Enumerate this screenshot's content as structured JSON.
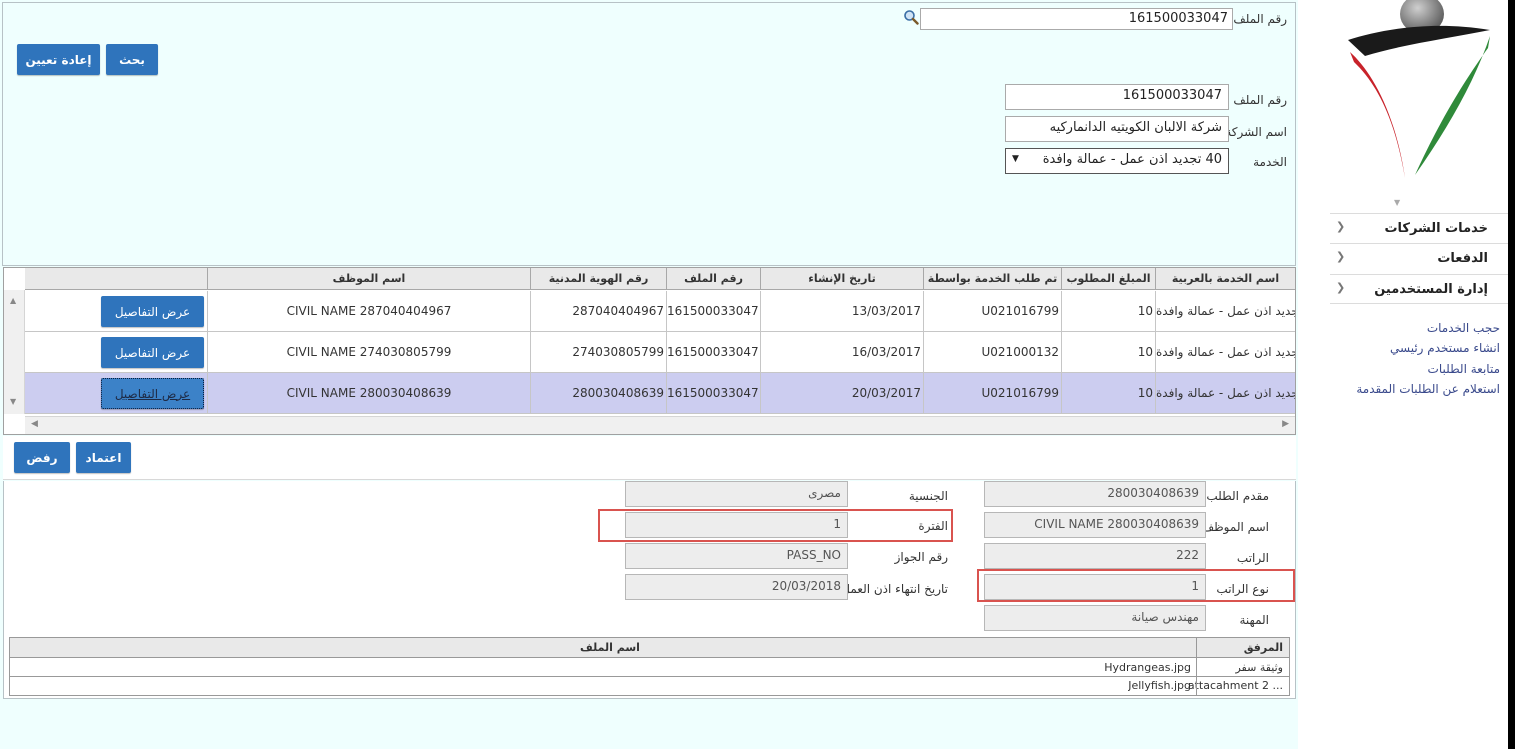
{
  "search": {
    "label": "رقم الملف",
    "value": "161500033047",
    "search_button": "بحث",
    "reset_button": "إعادة تعيين"
  },
  "file_info": {
    "file_no_label": "رقم الملف",
    "file_no_value": "161500033047",
    "company_label": "اسم الشركة",
    "company_value": "شركة الالبان الكويتيه الدانماركيه",
    "service_label": "الخدمة",
    "service_value": "40 تجديد اذن عمل - عمالة وافدة"
  },
  "grid": {
    "columns": [
      "اسم الخدمة بالعربية",
      "المبلغ المطلوب",
      "تم طلب الخدمة بواسطة",
      "تاريخ الإنشاء",
      "رقم الملف",
      "رقم الهوية المدنية",
      "اسم الموظف"
    ],
    "details_label": "عرض التفاصيل",
    "rows": [
      {
        "service": "تجديد اذن عمل - عمالة وافدة",
        "amount": "10",
        "requested_by": "U021016799",
        "created": "13/03/2017",
        "file_no": "161500033047",
        "civil_id": "287040404967",
        "employee": "CIVIL NAME 287040404967"
      },
      {
        "service": "تجديد اذن عمل - عمالة وافدة",
        "amount": "10",
        "requested_by": "U021000132",
        "created": "16/03/2017",
        "file_no": "161500033047",
        "civil_id": "274030805799",
        "employee": "CIVIL NAME 274030805799"
      },
      {
        "service": "تجديد اذن عمل - عمالة وافدة",
        "amount": "10",
        "requested_by": "U021016799",
        "created": "20/03/2017",
        "file_no": "161500033047",
        "civil_id": "280030408639",
        "employee": "CIVIL NAME 280030408639"
      }
    ]
  },
  "actions": {
    "approve": "اعتماد",
    "reject": "رفض"
  },
  "details": {
    "applicant_label": "مقدم الطلب",
    "applicant_value": "280030408639",
    "nationality_label": "الجنسية",
    "nationality_value": "مصرى",
    "employee_label": "اسم الموظف",
    "employee_value": "CIVIL NAME 280030408639",
    "period_label": "الفترة",
    "period_value": "1",
    "salary_label": "الراتب",
    "salary_value": "222",
    "passport_label": "رقم الجواز",
    "passport_value": "PASS_NO",
    "salary_type_label": "نوع الراتب",
    "salary_type_value": "1",
    "permit_end_label": "تاريخ انتهاء اذن العمل",
    "permit_end_value": "20/03/2018",
    "profession_label": "المهنة",
    "profession_value": "مهندس صيانة"
  },
  "attachments": {
    "col_attachment": "المرفق",
    "col_filename": "اسم الملف",
    "rows": [
      {
        "attachment": "وثيقة سفر",
        "filename": "Hydrangeas.jpg"
      },
      {
        "attachment": "attacahment 2 ...",
        "filename": "Jellyfish.jpg"
      }
    ]
  },
  "sidebar": {
    "menu": [
      "خدمات الشركات",
      "الدفعات",
      "إدارة المستخدمين"
    ],
    "links": [
      "حجب الخدمات",
      "انشاء مستخدم رئيسي",
      "متابعة الطلبات",
      "استعلام عن الطلبات المقدمة"
    ]
  },
  "colors": {
    "primary_button": "#2f74bc",
    "panel_background": "#effffe",
    "selected_row": "#cccdf0",
    "highlight_border": "#d9534f"
  }
}
